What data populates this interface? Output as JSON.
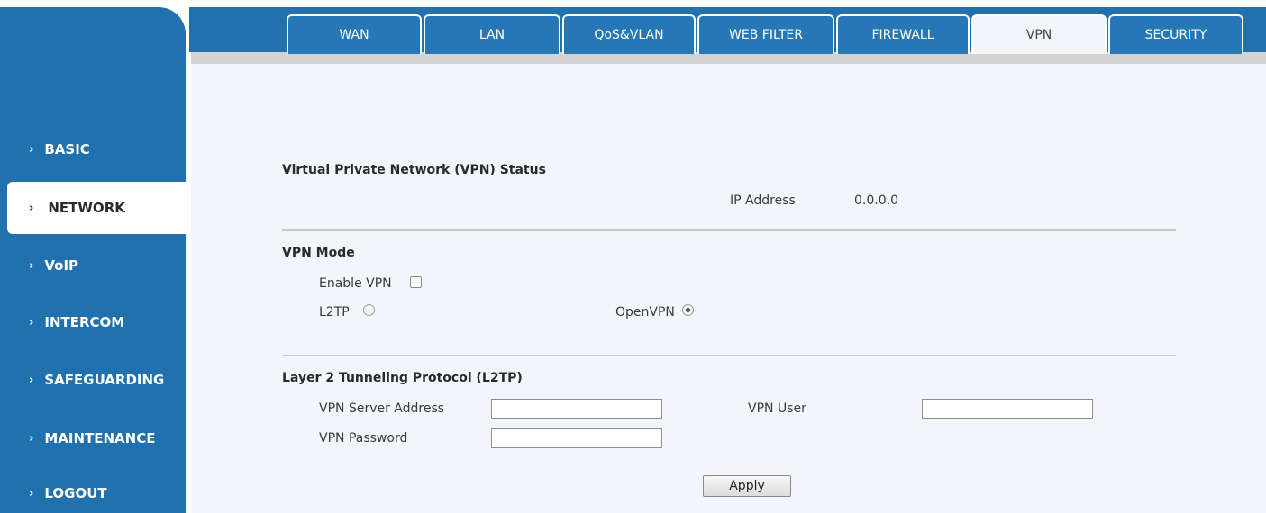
{
  "sidebar": {
    "items": [
      {
        "label": "BASIC",
        "chevron": "›",
        "active": false
      },
      {
        "label": "NETWORK",
        "chevron": "›",
        "active": true
      },
      {
        "label": "VoIP",
        "chevron": "›",
        "active": false
      },
      {
        "label": "INTERCOM",
        "chevron": "›",
        "active": false
      },
      {
        "label": "SAFEGUARDING",
        "chevron": "›",
        "active": false
      },
      {
        "label": "MAINTENANCE",
        "chevron": "›",
        "active": false
      },
      {
        "label": "LOGOUT",
        "chevron": "›",
        "active": false
      }
    ]
  },
  "tabs": [
    {
      "label": "WAN",
      "active": false
    },
    {
      "label": "LAN",
      "active": false
    },
    {
      "label": "QoS&VLAN",
      "active": false
    },
    {
      "label": "WEB FILTER",
      "active": false
    },
    {
      "label": "FIREWALL",
      "active": false
    },
    {
      "label": "VPN",
      "active": true
    },
    {
      "label": "SECURITY",
      "active": false
    }
  ],
  "status": {
    "title": "Virtual Private Network (VPN) Status",
    "ip_label": "IP Address",
    "ip_value": "0.0.0.0"
  },
  "mode": {
    "title": "VPN Mode",
    "enable_label": "Enable VPN",
    "enable_checked": false,
    "l2tp_label": "L2TP",
    "l2tp_selected": false,
    "openvpn_label": "OpenVPN",
    "openvpn_selected": true
  },
  "l2tp": {
    "title": "Layer 2 Tunneling Protocol (L2TP)",
    "server_label": "VPN Server Address",
    "server_value": "",
    "user_label": "VPN User",
    "user_value": "",
    "password_label": "VPN Password",
    "password_value": ""
  },
  "apply_label": "Apply",
  "colors": {
    "primary": "#2071ad",
    "content_bg": "#f2f6fa",
    "strip": "#d3d3d3"
  }
}
